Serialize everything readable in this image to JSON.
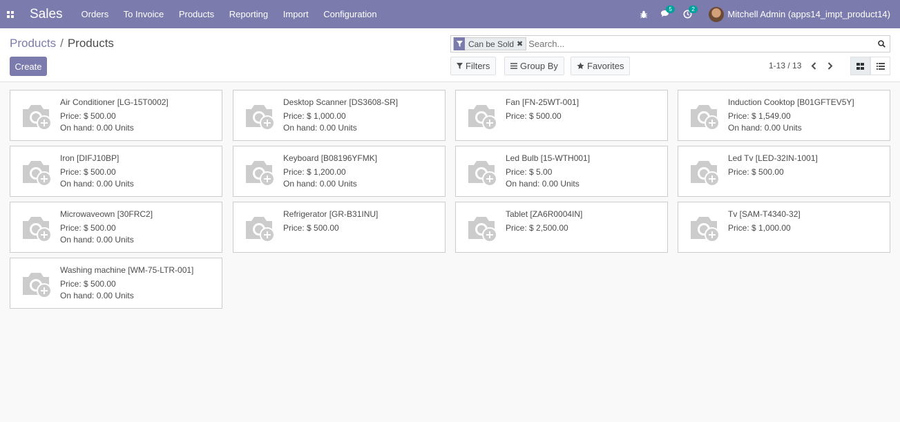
{
  "app": {
    "brand": "Sales",
    "menu": [
      "Orders",
      "To Invoice",
      "Products",
      "Reporting",
      "Import",
      "Configuration"
    ],
    "messages_count": "5",
    "activities_count": "2",
    "user_name": "Mitchell Admin (apps14_impt_product14)"
  },
  "breadcrumb": {
    "parent": "Products",
    "separator": "/",
    "current": "Products"
  },
  "toolbar": {
    "create_label": "Create"
  },
  "search": {
    "facet_label": "Can be Sold",
    "facet_remove": "✖",
    "placeholder": "Search..."
  },
  "controls": {
    "filters_label": "Filters",
    "group_by_label": "Group By",
    "favorites_label": "Favorites"
  },
  "pager": {
    "value": "1-13 / 13"
  },
  "products": [
    {
      "name": "Air Conditioner [LG-15T0002]",
      "price": "Price: $ 500.00",
      "on_hand": "On hand: 0.00 Units"
    },
    {
      "name": "Desktop Scanner [DS3608-SR]",
      "price": "Price: $ 1,000.00",
      "on_hand": "On hand: 0.00 Units"
    },
    {
      "name": "Fan [FN-25WT-001]",
      "price": "Price: $ 500.00",
      "on_hand": ""
    },
    {
      "name": "Induction Cooktop [B01GFTEV5Y]",
      "price": "Price: $ 1,549.00",
      "on_hand": "On hand: 0.00 Units"
    },
    {
      "name": "Iron [DIFJ10BP]",
      "price": "Price: $ 500.00",
      "on_hand": "On hand: 0.00 Units"
    },
    {
      "name": "Keyboard [B08196YFMK]",
      "price": "Price: $ 1,200.00",
      "on_hand": "On hand: 0.00 Units"
    },
    {
      "name": "Led Bulb [15-WTH001]",
      "price": "Price: $ 5.00",
      "on_hand": "On hand: 0.00 Units"
    },
    {
      "name": "Led Tv [LED-32IN-1001]",
      "price": "Price: $ 500.00",
      "on_hand": ""
    },
    {
      "name": "Microwaveown [30FRC2]",
      "price": "Price: $ 500.00",
      "on_hand": "On hand: 0.00 Units"
    },
    {
      "name": "Refrigerator [GR-B31INU]",
      "price": "Price: $ 500.00",
      "on_hand": ""
    },
    {
      "name": "Tablet [ZA6R0004IN]",
      "price": "Price: $ 2,500.00",
      "on_hand": ""
    },
    {
      "name": "Tv [SAM-T4340-32]",
      "price": "Price: $ 1,000.00",
      "on_hand": ""
    },
    {
      "name": "Washing machine [WM-75-LTR-001]",
      "price": "Price: $ 500.00",
      "on_hand": "On hand: 0.00 Units"
    }
  ],
  "colors": {
    "navbar": "#7c7bad",
    "accent": "#7c7bad",
    "badge": "#00a09d"
  }
}
